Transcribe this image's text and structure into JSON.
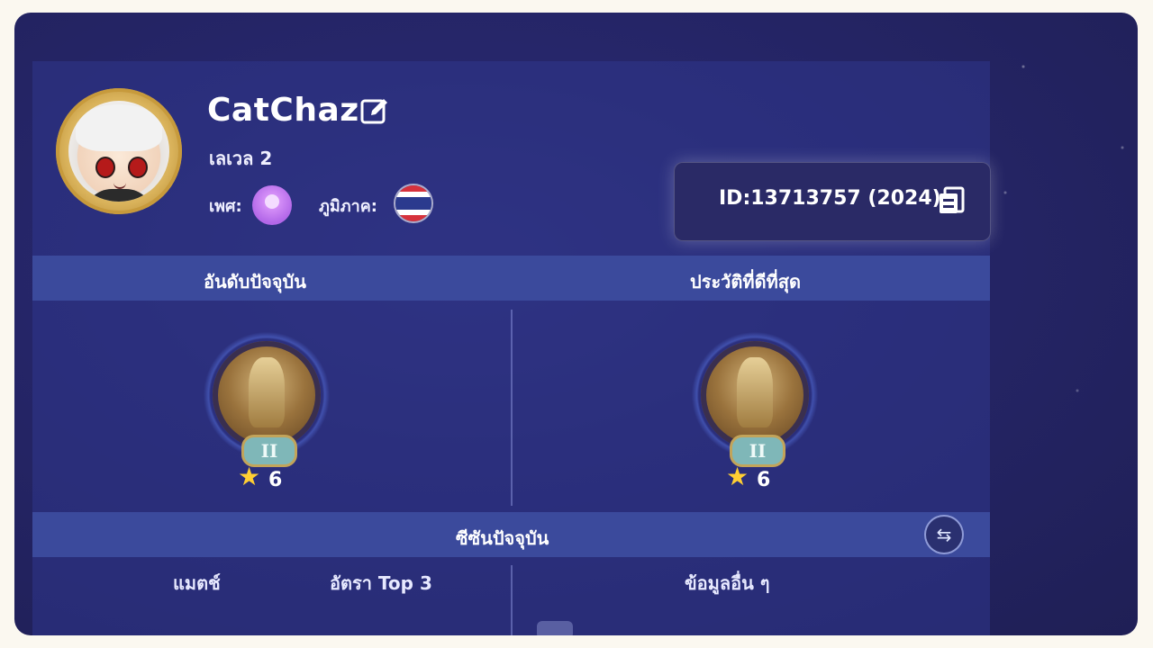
{
  "profile": {
    "name": "CatChaz",
    "level": "เลเวล 2",
    "gender_label": "เพศ:",
    "region_label": "ภูมิภาค:",
    "id_text": "ID:13713757 (2024)"
  },
  "sections": {
    "current_rank": "อันดับปัจจุบัน",
    "best_history": "ประวัติที่ดีที่สุด",
    "current_season": "ซีซันปัจจุบัน",
    "match": "แมตช์",
    "top3_rate": "อัตรา Top 3",
    "other_info": "ข้อมูลอื่น ๆ"
  },
  "ranks": [
    {
      "tier": "II",
      "stars": "6"
    },
    {
      "tier": "II",
      "stars": "6"
    }
  ],
  "colors": {
    "background": "#26266a",
    "panel_bar": "#3b4a9c",
    "star": "#ffce33"
  },
  "icons": [
    "edit-icon",
    "gender-icon",
    "thai-flag-icon",
    "copy-icon",
    "star-icon",
    "swap-icon"
  ]
}
